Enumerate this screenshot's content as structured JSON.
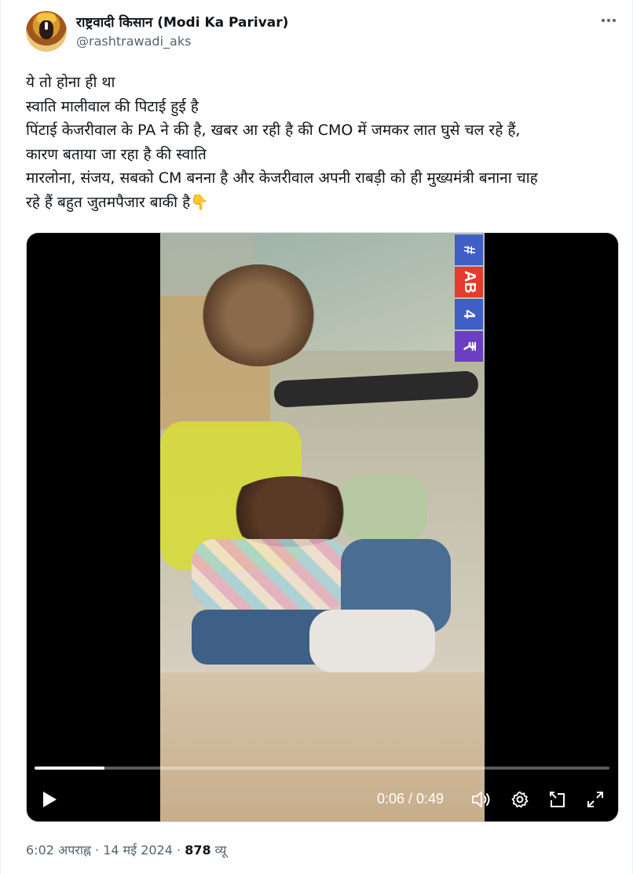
{
  "author": {
    "display_name": "राष्ट्रवादी किसान (Modi Ka Parivar)",
    "handle": "@rashtrawadi_aks"
  },
  "tweet": {
    "lines": [
      "ये तो होना ही था",
      "स्वाति मालीवाल की पिटाई हुई है",
      "पिंटाई केजरीवाल के PA ने की है, खबर आ रही है की CMO में जमकर लात घुसे चल रहे हैं,",
      "कारण बताया जा रहा है की स्वाति",
      "मारलोना, संजय, सबको CM बनना है और केजरीवाल अपनी राबड़ी को ही मुख्यमंत्री बनाना चाह",
      "रहे हैं  बहुत जुतमपैजार बाकी है👇"
    ]
  },
  "video": {
    "time_display": "0:06 / 0:49",
    "progress_fraction": 0.122,
    "channel_badges": [
      "#",
      "AB",
      "4",
      "₹"
    ],
    "icons": {
      "play": "play-icon",
      "volume": "volume-icon",
      "settings": "gear-icon",
      "popout": "popout-icon",
      "fullscreen": "fullscreen-icon"
    }
  },
  "meta": {
    "time": "6:02 अपराह्न",
    "separator": " · ",
    "date": "14 मई 2024",
    "views_count": "878",
    "views_label": " व्यू"
  },
  "colors": {
    "text_primary": "#0f1419",
    "text_secondary": "#536471",
    "badge_blue": "#3f5fc4",
    "badge_red": "#e33b2e",
    "badge_purple": "#6a3fc4"
  }
}
